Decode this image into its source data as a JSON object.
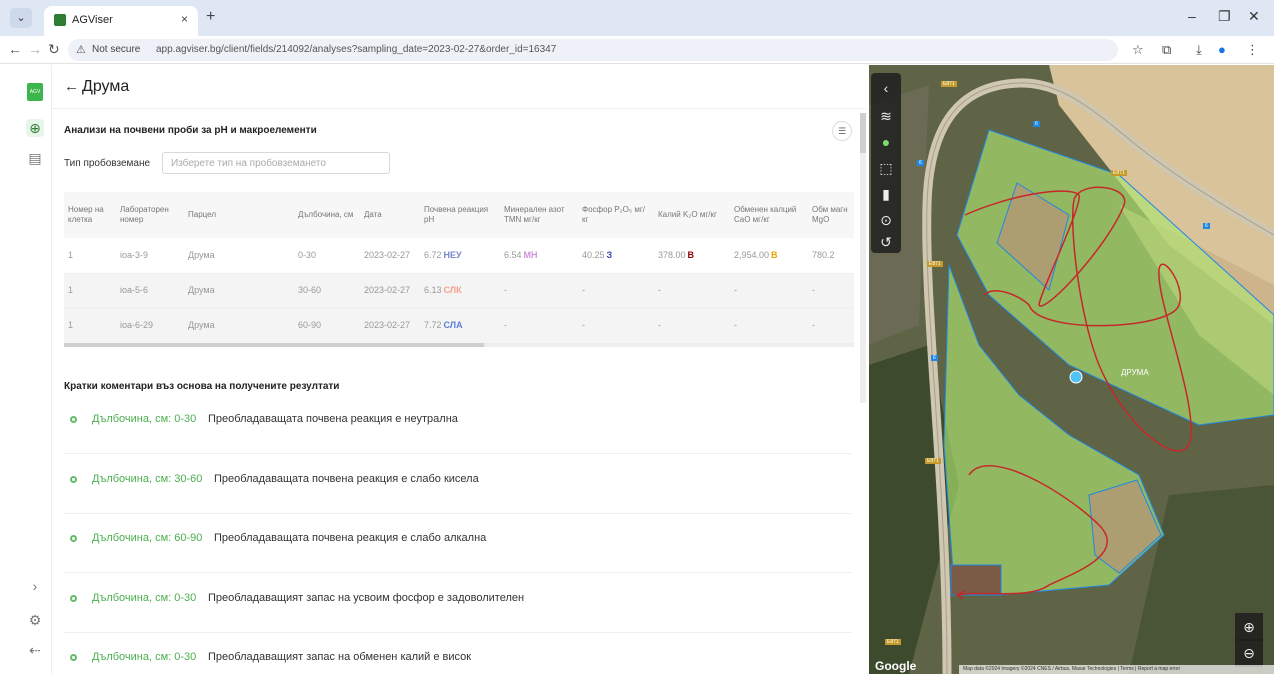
{
  "browser": {
    "tab_title": "AGViser",
    "tab_close": "×",
    "new_tab": "+",
    "security_label": "Not secure",
    "url": "app.agviser.bg/client/fields/214092/analyses?sampling_date=2023-02-27&order_id=16347"
  },
  "header": {
    "back_icon": "←",
    "title": "Друма"
  },
  "section": {
    "title": "Анализи на почвени проби за pH и макроелементи",
    "filter_label": "Тип пробовземане",
    "filter_placeholder": "Изберете тип на пробовземането"
  },
  "table": {
    "headers": [
      "Номер на клетка",
      "Лабораторен номер",
      "Парцел",
      "Дълбочина, см",
      "Дата",
      "Почвена реакция pH",
      "Минерален азот TMN мг/кг",
      "Фосфор P₂O₅ мг/кг",
      "Калий K₂O мг/кг",
      "Обменен калций CaO мг/кг",
      "Обм магн MgO"
    ],
    "rows": [
      {
        "cell": "1",
        "lab": "ioa-3-9",
        "parcel": "Друма",
        "depth": "0-30",
        "date": "2023-02-27",
        "ph": "6.72",
        "ph_tag": "НЕУ",
        "tmn": "6.54",
        "tmn_tag": "МН",
        "p": "40.25",
        "p_tag": "З",
        "k": "378.00",
        "k_tag": "В",
        "ca": "2,954.00",
        "ca_tag": "В",
        "mg": "780.2"
      },
      {
        "cell": "1",
        "lab": "ioa-5-6",
        "parcel": "Друма",
        "depth": "30-60",
        "date": "2023-02-27",
        "ph": "6.13",
        "ph_tag": "СЛК",
        "tmn": "-",
        "tmn_tag": "",
        "p": "-",
        "p_tag": "",
        "k": "-",
        "k_tag": "",
        "ca": "-",
        "ca_tag": "",
        "mg": "-"
      },
      {
        "cell": "1",
        "lab": "ioa-6-29",
        "parcel": "Друма",
        "depth": "60-90",
        "date": "2023-02-27",
        "ph": "7.72",
        "ph_tag": "СЛА",
        "tmn": "-",
        "tmn_tag": "",
        "p": "-",
        "p_tag": "",
        "k": "-",
        "k_tag": "",
        "ca": "-",
        "ca_tag": "",
        "mg": "-"
      }
    ]
  },
  "comments": {
    "title": "Кратки коментари въз основа на получените резултати",
    "items": [
      {
        "depth": "Дълбочина, см: 0-30",
        "text": "Преобладаващата почвена реакция е неутрална"
      },
      {
        "depth": "Дълбочина, см: 30-60",
        "text": "Преобладаващата почвена реакция е слабо кисела"
      },
      {
        "depth": "Дълбочина, см: 60-90",
        "text": "Преобладаващата почвена реакция е слабо алкална"
      },
      {
        "depth": "Дълбочина, см: 0-30",
        "text": "Преобладаващият запас на усвоим фосфор е задоволителен"
      },
      {
        "depth": "Дълбочина, см: 0-30",
        "text": "Преобладаващият запас на обменен калий е висок"
      }
    ]
  },
  "map": {
    "google_label": "Google",
    "attribution": "Map data ©2024 Imagery ©2024 CNES / Airbus, Maxar Technologies | Terms | Report a map error",
    "field_name": "ДРУМА",
    "road_label": "E871",
    "zoom_in": "⊕",
    "zoom_out": "⊖"
  },
  "colors": {
    "accent": "#4caf50",
    "tag_neutral": "#7986cb",
    "tag_mn": "#ce93d8",
    "tag_z": "#3949ab",
    "tag_v_red": "#8e0000",
    "tag_v_orange": "#e6a100",
    "tag_slk": "#f4a38d",
    "tag_sla": "#5c7cdb",
    "field_fill": "#9ccc65",
    "track": "#c62828"
  }
}
